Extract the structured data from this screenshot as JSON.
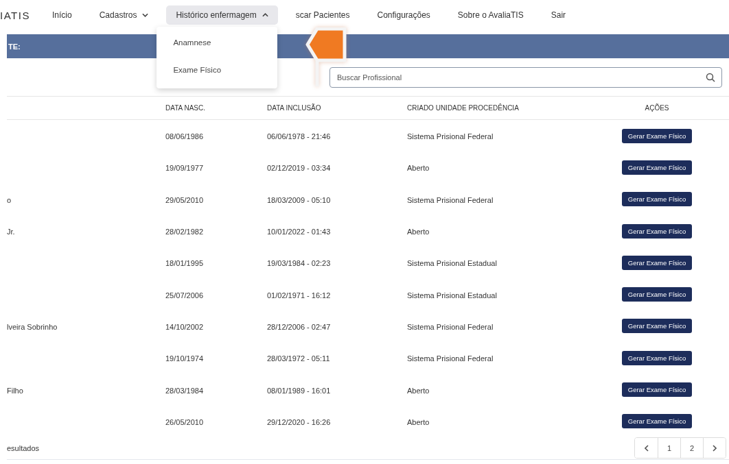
{
  "nav": {
    "logo": "IATIS",
    "items": [
      {
        "label": "Início",
        "kind": "link",
        "selected": false
      },
      {
        "label": "Cadastros",
        "kind": "dropdown",
        "selected": false,
        "expanded": false
      },
      {
        "label": "Histórico enfermagem",
        "kind": "dropdown",
        "selected": true,
        "expanded": true,
        "menu": [
          "Anamnese",
          "Exame Físico"
        ]
      },
      {
        "label": "scar Pacientes",
        "kind": "link",
        "selected": false
      },
      {
        "label": "Configurações",
        "kind": "link",
        "selected": false
      },
      {
        "label": "Sobre o AvaliaTIS",
        "kind": "link",
        "selected": false
      },
      {
        "label": "Sair",
        "kind": "link",
        "selected": false
      }
    ]
  },
  "banner": {
    "title": "TE:"
  },
  "search": {
    "placeholder": "Buscar Profissional"
  },
  "table": {
    "columns": [
      "",
      "DATA NASC.",
      "DATA INCLUSÃO",
      "CRIADO UNIDADE PROCEDÊNCIA",
      "AÇÕES"
    ],
    "rows": [
      {
        "name": "",
        "birth": "08/06/1986",
        "included": "06/06/1978 - 21:46",
        "unit": "Sistema Prisional Federal",
        "action": "Gerar Exame Físico"
      },
      {
        "name": "",
        "birth": "19/09/1977",
        "included": "02/12/2019 - 03:34",
        "unit": "Aberto",
        "action": "Gerar Exame Físico"
      },
      {
        "name": "o",
        "birth": "29/05/2010",
        "included": "18/03/2009 - 05:10",
        "unit": "Sistema Prisional Federal",
        "action": "Gerar Exame Físico"
      },
      {
        "name": "Jr.",
        "birth": "28/02/1982",
        "included": "10/01/2022 - 01:43",
        "unit": "Aberto",
        "action": "Gerar Exame Físico"
      },
      {
        "name": "",
        "birth": "18/01/1995",
        "included": "19/03/1984 - 02:23",
        "unit": "Sistema Prisional Estadual",
        "action": "Gerar Exame Físico"
      },
      {
        "name": "",
        "birth": "25/07/2006",
        "included": "01/02/1971 - 16:12",
        "unit": "Sistema Prisional Estadual",
        "action": "Gerar Exame Físico"
      },
      {
        "name": "lveira Sobrinho",
        "birth": "14/10/2002",
        "included": "28/12/2006 - 02:47",
        "unit": "Sistema Prisional Federal",
        "action": "Gerar Exame Físico"
      },
      {
        "name": "",
        "birth": "19/10/1974",
        "included": "28/03/1972 - 05:11",
        "unit": "Sistema Prisional Federal",
        "action": "Gerar Exame Físico"
      },
      {
        "name": "Filho",
        "birth": "28/03/1984",
        "included": "08/01/1989 - 16:01",
        "unit": "Aberto",
        "action": "Gerar Exame Físico"
      },
      {
        "name": "",
        "birth": "26/05/2010",
        "included": "29/12/2020 - 16:26",
        "unit": "Aberto",
        "action": "Gerar Exame Físico"
      }
    ]
  },
  "footer": {
    "results": "esultados",
    "pages": [
      {
        "label": "1",
        "selected": false
      },
      {
        "label": "2",
        "selected": false
      }
    ]
  }
}
